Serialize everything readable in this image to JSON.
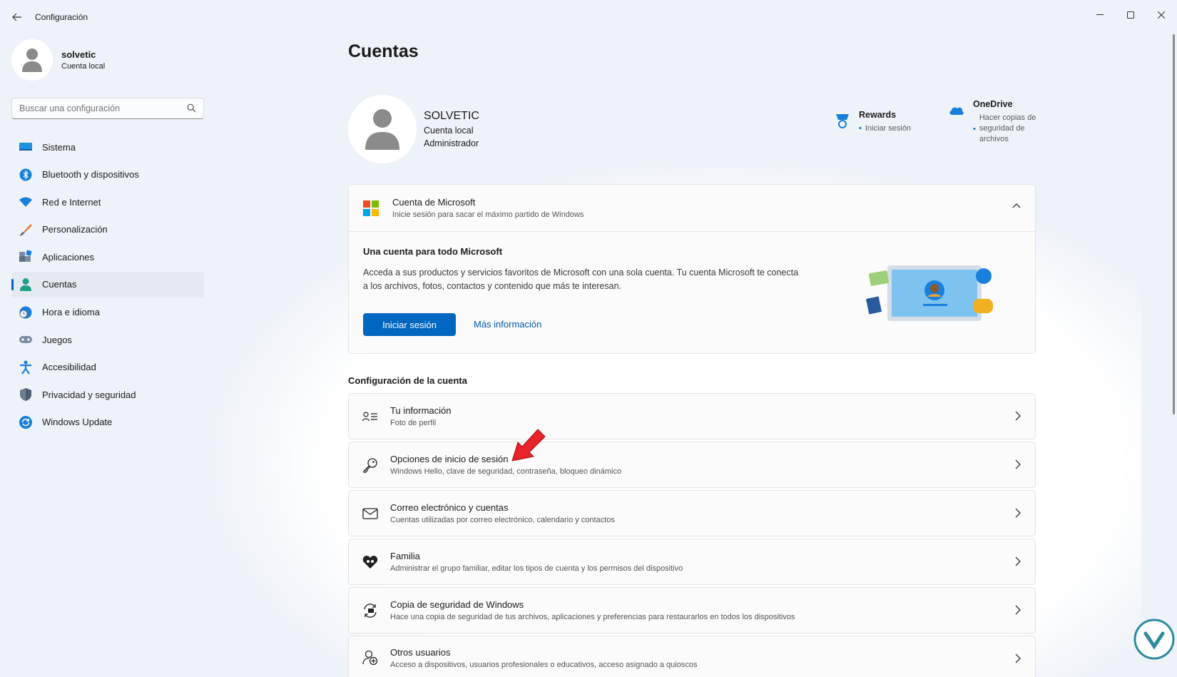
{
  "app": {
    "title": "Configuración"
  },
  "user": {
    "name": "solvetic",
    "type": "Cuenta local"
  },
  "search": {
    "placeholder": "Buscar una configuración"
  },
  "sidebar": {
    "items": [
      {
        "label": "Sistema",
        "icon": "monitor-icon"
      },
      {
        "label": "Bluetooth y dispositivos",
        "icon": "bluetooth-icon"
      },
      {
        "label": "Red e Internet",
        "icon": "wifi-icon"
      },
      {
        "label": "Personalización",
        "icon": "brush-icon"
      },
      {
        "label": "Aplicaciones",
        "icon": "apps-icon"
      },
      {
        "label": "Cuentas",
        "icon": "person-icon",
        "active": true
      },
      {
        "label": "Hora e idioma",
        "icon": "globe-clock-icon"
      },
      {
        "label": "Juegos",
        "icon": "gamepad-icon"
      },
      {
        "label": "Accesibilidad",
        "icon": "accessibility-icon"
      },
      {
        "label": "Privacidad y seguridad",
        "icon": "shield-icon"
      },
      {
        "label": "Windows Update",
        "icon": "update-icon"
      }
    ]
  },
  "main": {
    "title": "Cuentas",
    "profile": {
      "name": "SOLVETIC",
      "type": "Cuenta local",
      "role": "Administrador"
    },
    "rewards": {
      "title": "Rewards",
      "action": "Iniciar sesión"
    },
    "onedrive": {
      "title": "OneDrive",
      "action": "Hacer copias de seguridad de archivos"
    },
    "microsoft_account": {
      "title": "Cuenta de Microsoft",
      "subtitle": "Inicie sesión para sacar el máximo partido de Windows",
      "body_title": "Una cuenta para todo Microsoft",
      "body_desc": "Acceda a sus productos y servicios favoritos de Microsoft con una sola cuenta. Tu cuenta Microsoft te conecta a los archivos, fotos, contactos y contenido que más te interesan.",
      "signin_button": "Iniciar sesión",
      "more_link": "Más información"
    },
    "account_settings_title": "Configuración de la cuenta",
    "rows": [
      {
        "title": "Tu información",
        "subtitle": "Foto de perfil",
        "icon": "contact-card-icon"
      },
      {
        "title": "Opciones de inicio de sesión",
        "subtitle": "Windows Hello, clave de seguridad, contraseña, bloqueo dinámico",
        "icon": "key-icon"
      },
      {
        "title": "Correo electrónico y cuentas",
        "subtitle": "Cuentas utilizadas por correo electrónico, calendario y contactos",
        "icon": "mail-icon"
      },
      {
        "title": "Familia",
        "subtitle": "Administrar el grupo familiar, editar los tipos de cuenta y los permisos del dispositivo",
        "icon": "family-heart-icon"
      },
      {
        "title": "Copia de seguridad de Windows",
        "subtitle": "Hace una copia de seguridad de tus archivos, aplicaciones y preferencias para restaurarlos en todos los dispositivos",
        "icon": "backup-icon"
      },
      {
        "title": "Otros usuarios",
        "subtitle": "Acceso a dispositivos, usuarios profesionales o educativos, acceso asignado a quioscos",
        "icon": "add-user-icon"
      }
    ]
  },
  "colors": {
    "accent": "#0067c0",
    "background": "#eef3f9",
    "annotation_arrow": "#e8232a"
  }
}
